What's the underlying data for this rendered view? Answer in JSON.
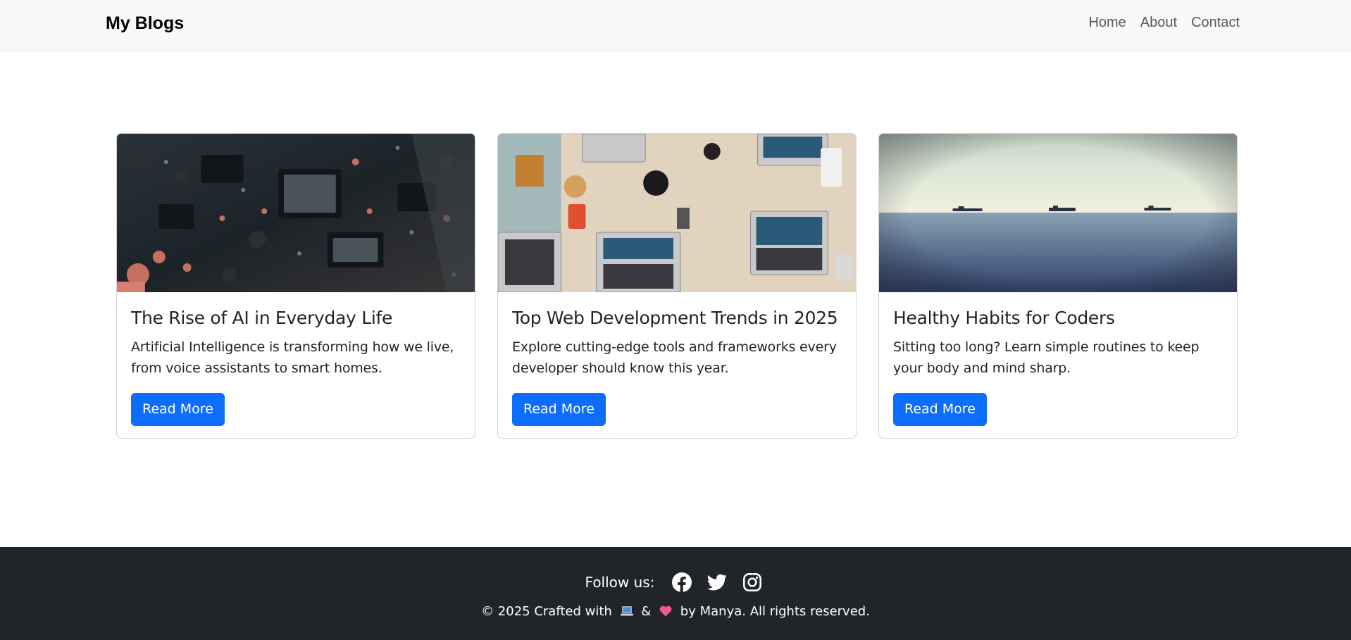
{
  "navbar": {
    "brand": "My Blogs",
    "links": [
      "Home",
      "About",
      "Contact"
    ]
  },
  "cards": [
    {
      "title": "The Rise of AI in Everyday Life",
      "text": "Artificial Intelligence is transforming how we live, from voice assistants to smart homes.",
      "button": "Read More",
      "image": "circuit-board-photo"
    },
    {
      "title": "Top Web Development Trends in 2025",
      "text": "Explore cutting-edge tools and frameworks every developer should know this year.",
      "button": "Read More",
      "image": "laptops-on-desk-photo"
    },
    {
      "title": "Healthy Habits for Coders",
      "text": "Sitting too long? Learn simple routines to keep your body and mind sharp.",
      "button": "Read More",
      "image": "sea-with-ships-photo"
    }
  ],
  "footer": {
    "follow_label": "Follow us:",
    "social_icons": [
      "facebook-icon",
      "twitter-icon",
      "instagram-icon"
    ],
    "copyright_prefix": "© 2025 Crafted with",
    "copyright_amp": "&",
    "copyright_suffix": "by Manya. All rights reserved."
  },
  "colors": {
    "primary": "#0d6efd",
    "navbar_bg": "#f8f9fa",
    "footer_bg": "#212529"
  }
}
